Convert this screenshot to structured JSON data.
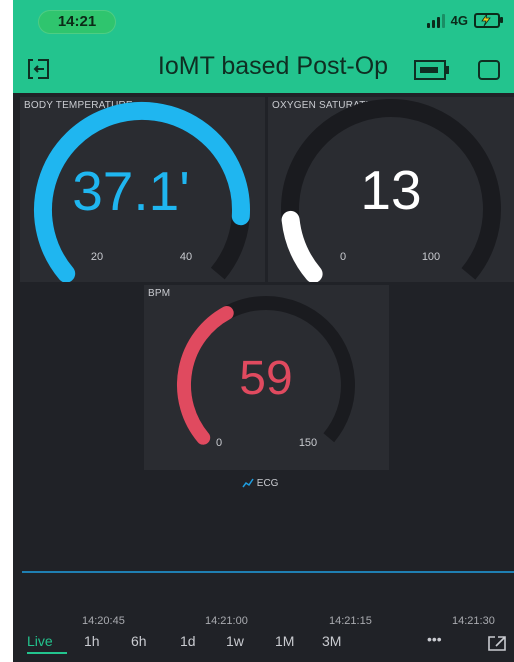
{
  "status": {
    "time": "14:21",
    "network": "4G"
  },
  "header": {
    "title": "IoMT based Post-Op"
  },
  "widgets": {
    "temperature": {
      "label": "BODY TEMPERATURE",
      "value": "37.1'",
      "min": "20",
      "max": "40",
      "color": "#1fb6f0",
      "fraction": 0.86
    },
    "oxygen": {
      "label": "OXYGEN SATURATION",
      "value": "13",
      "min": "0",
      "max": "100",
      "color": "#ffffff",
      "fraction": 0.13
    },
    "bpm": {
      "label": "BPM",
      "value": "59",
      "min": "0",
      "max": "150",
      "color": "#e04a5f",
      "fraction": 0.39
    }
  },
  "chart_data": {
    "type": "line",
    "title": "ECG",
    "x_ticks": [
      "14:20:45",
      "14:21:00",
      "14:21:15",
      "14:21:30"
    ],
    "series": [
      {
        "name": "ECG",
        "color": "#1f9ee0",
        "values": [
          0,
          0,
          0,
          0
        ]
      }
    ]
  },
  "time_ranges": [
    "Live",
    "1h",
    "6h",
    "1d",
    "1w",
    "1M",
    "3M"
  ],
  "active_range": "Live",
  "more_label": "•••"
}
